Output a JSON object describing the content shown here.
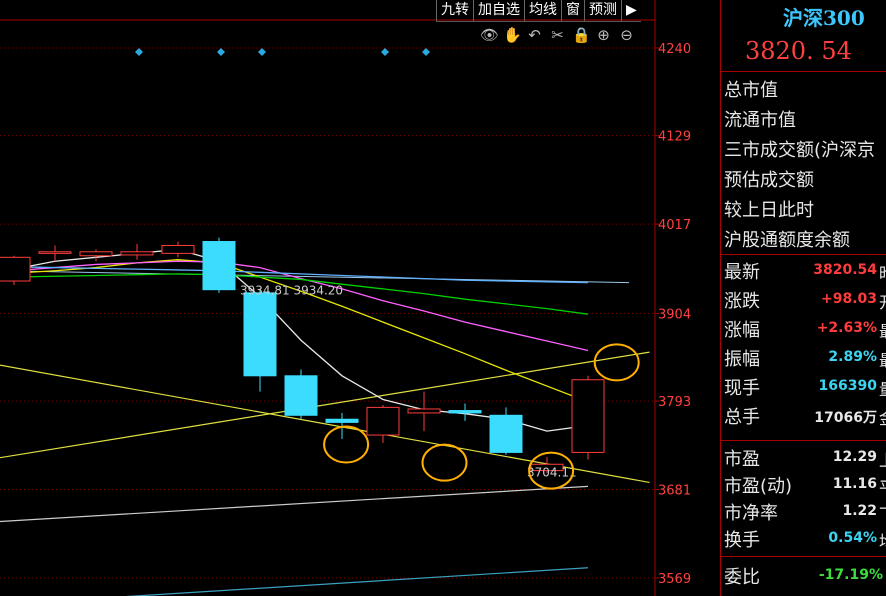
{
  "toolbar": {
    "buttons": [
      "九转",
      "加自选",
      "均线",
      "窗",
      "预测"
    ]
  },
  "tool_icons": [
    {
      "name": "eye-icon",
      "glyph": "👁"
    },
    {
      "name": "hand-icon",
      "glyph": "✋"
    },
    {
      "name": "undo-icon",
      "glyph": "↶"
    },
    {
      "name": "scissors-icon",
      "glyph": "✂"
    },
    {
      "name": "lock-icon",
      "glyph": "🔒"
    },
    {
      "name": "zoom-in-icon",
      "glyph": "⊕"
    },
    {
      "name": "zoom-out-icon",
      "glyph": "⊖"
    }
  ],
  "panel": {
    "name": "沪深300",
    "price": "3820. 54",
    "info_labels": [
      "总市值",
      "流通市值",
      "三市成交额(沪深京",
      "预估成交额",
      "较上日此时",
      "沪股通额度余额"
    ],
    "quotes_a": [
      {
        "label": "最新",
        "value": "3820.54",
        "color": "red",
        "suffix": "昨"
      },
      {
        "label": "涨跌",
        "value": "+98.03",
        "color": "red",
        "suffix": "开"
      },
      {
        "label": "涨幅",
        "value": "+2.63%",
        "color": "red",
        "suffix": "最"
      },
      {
        "label": "振幅",
        "value": "2.89%",
        "color": "cyan",
        "suffix": "最"
      },
      {
        "label": "现手",
        "value": "166390",
        "color": "cyan",
        "suffix": "量"
      },
      {
        "label": "总手",
        "value": "17066万",
        "color": "white",
        "suffix": "金"
      }
    ],
    "quotes_b": [
      {
        "label": "市盈",
        "value": "12.29",
        "color": "white",
        "suffix": "上"
      },
      {
        "label": "市盈(动)",
        "value": "11.16",
        "color": "white",
        "suffix": "平"
      },
      {
        "label": "市净率",
        "value": "1.22",
        "color": "white",
        "suffix": "下"
      },
      {
        "label": "换手",
        "value": "0.54%",
        "color": "cyan",
        "suffix": "均"
      }
    ],
    "weibi": {
      "label": "委比",
      "value": "-17.19%",
      "color": "green"
    }
  },
  "chart_data": {
    "type": "candlestick",
    "y_ticks": [
      4240,
      4129,
      4017,
      3904,
      3793,
      3681,
      3569
    ],
    "ylim": [
      3569,
      4240
    ],
    "grid": true,
    "colors": {
      "up": "#ff3c3c",
      "down": "#3cdcff",
      "ma5": "#e8e8e8",
      "ma10": "#e8e800",
      "ma20": "#ff60ff",
      "ma30": "#00d000",
      "ma60": "#60b0ff",
      "trendline": "#e0e040",
      "highlight": "#ffb000"
    },
    "candles": [
      {
        "o": 3945,
        "c": 3975,
        "h": 3977,
        "l": 3940
      },
      {
        "o": 3980,
        "c": 3982,
        "h": 3990,
        "l": 3970
      },
      {
        "o": 3977,
        "c": 3982,
        "h": 3985,
        "l": 3970
      },
      {
        "o": 3978,
        "c": 3982,
        "h": 3992,
        "l": 3972
      },
      {
        "o": 3980,
        "c": 3990,
        "h": 3995,
        "l": 3975
      },
      {
        "o": 3995,
        "c": 3934,
        "h": 4000,
        "l": 3930
      },
      {
        "o": 3930,
        "c": 3825,
        "h": 3934,
        "l": 3805
      },
      {
        "o": 3825,
        "c": 3775,
        "h": 3833,
        "l": 3770
      },
      {
        "o": 3770,
        "c": 3766,
        "h": 3778,
        "l": 3745
      },
      {
        "o": 3750,
        "c": 3785,
        "h": 3788,
        "l": 3740
      },
      {
        "o": 3778,
        "c": 3783,
        "h": 3805,
        "l": 3755
      },
      {
        "o": 3781,
        "c": 3778,
        "h": 3790,
        "l": 3768
      },
      {
        "o": 3775,
        "c": 3728,
        "h": 3785,
        "l": 3725
      },
      {
        "o": 3705,
        "c": 3713,
        "h": 3722,
        "l": 3702
      },
      {
        "o": 3728,
        "c": 3820,
        "h": 3825,
        "l": 3719
      }
    ],
    "ma_lines": [
      {
        "key": "ma5",
        "values": [
          3960,
          3970,
          3975,
          3980,
          3985,
          3970,
          3925,
          3870,
          3825,
          3795,
          3782,
          3777,
          3770,
          3755,
          3762
        ]
      },
      {
        "key": "ma10",
        "values": [
          3955,
          3958,
          3962,
          3968,
          3972,
          3968,
          3950,
          3932,
          3913,
          3893,
          3873,
          3853,
          3832,
          3812,
          3792
        ]
      },
      {
        "key": "ma20",
        "values": [
          3958,
          3962,
          3966,
          3968,
          3970,
          3969,
          3962,
          3948,
          3935,
          3920,
          3907,
          3893,
          3881,
          3869,
          3857
        ]
      },
      {
        "key": "ma30",
        "values": [
          3950,
          3951,
          3952,
          3953,
          3954,
          3953,
          3950,
          3947,
          3941,
          3935,
          3929,
          3922,
          3916,
          3910,
          3903
        ]
      },
      {
        "key": "ma60",
        "values": [
          3963,
          3962,
          3961,
          3960,
          3959,
          3958,
          3956,
          3954,
          3952,
          3950,
          3948,
          3946,
          3945,
          3944,
          3943
        ]
      }
    ],
    "annotations": [
      {
        "text": "3934.81  3934.20",
        "x_index": 6,
        "y": 3934
      },
      {
        "text": "3704.11",
        "x_index": 13,
        "y": 3704
      }
    ],
    "markers_index": [
      3,
      5,
      6,
      9,
      10
    ],
    "highlight_circles": [
      {
        "x_index": 8.1,
        "y": 3738
      },
      {
        "x_index": 10.5,
        "y": 3715
      },
      {
        "x_index": 13.1,
        "y": 3705
      },
      {
        "x_index": 14.7,
        "y": 3842
      }
    ]
  }
}
